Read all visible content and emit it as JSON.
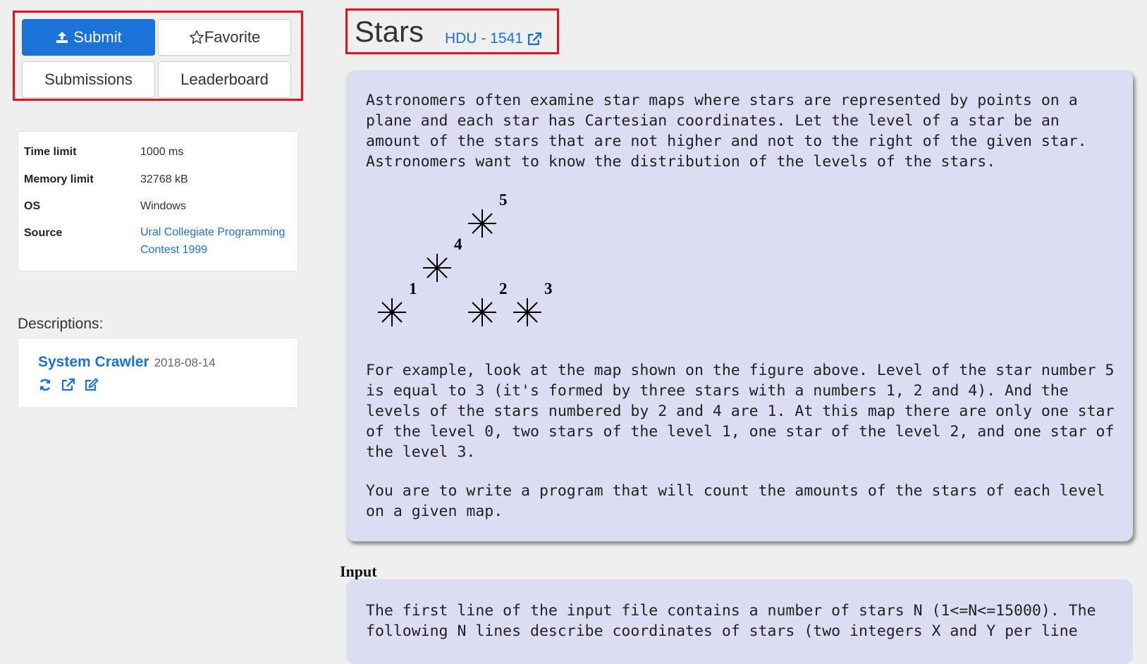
{
  "actions": {
    "submit": "Submit",
    "favorite": "Favorite",
    "submissions": "Submissions",
    "leaderboard": "Leaderboard"
  },
  "info": {
    "time_limit_label": "Time limit",
    "time_limit_value": "1000 ms",
    "memory_limit_label": "Memory limit",
    "memory_limit_value": "32768 kB",
    "os_label": "OS",
    "os_value": "Windows",
    "source_label": "Source",
    "source_value": "Ural Collegiate Programming Contest 1999"
  },
  "descriptions": {
    "heading": "Descriptions:",
    "author": "System Crawler",
    "date": "2018-08-14"
  },
  "problem": {
    "title": "Stars",
    "origin_link": "HDU - 1541",
    "intro": "Astronomers often examine star maps where stars are represented by points on a plane and each star has Cartesian coordinates. Let the level of a star be an amount of the stars that are not higher and not to the right of the given star. Astronomers want to know the distribution of the levels of the stars.",
    "figure_labels": [
      "1",
      "2",
      "3",
      "4",
      "5"
    ],
    "example": "For example, look at the map shown on the figure above. Level of the star number 5 is equal to 3 (it's formed by three stars with a numbers 1, 2 and 4). And the levels of the stars numbered by 2 and 4 are 1. At this map there are only one star of the level 0, two stars of the level 1, one star of the level 2, and one star of the level 3.",
    "task": "You are to write a program that will count the amounts of the stars of each level on a given map.",
    "input_heading": "Input",
    "input_text": "The first line of the input file contains a number of stars N (1<=N<=15000). The following N lines describe coordinates of stars (two integers X and Y per line"
  }
}
